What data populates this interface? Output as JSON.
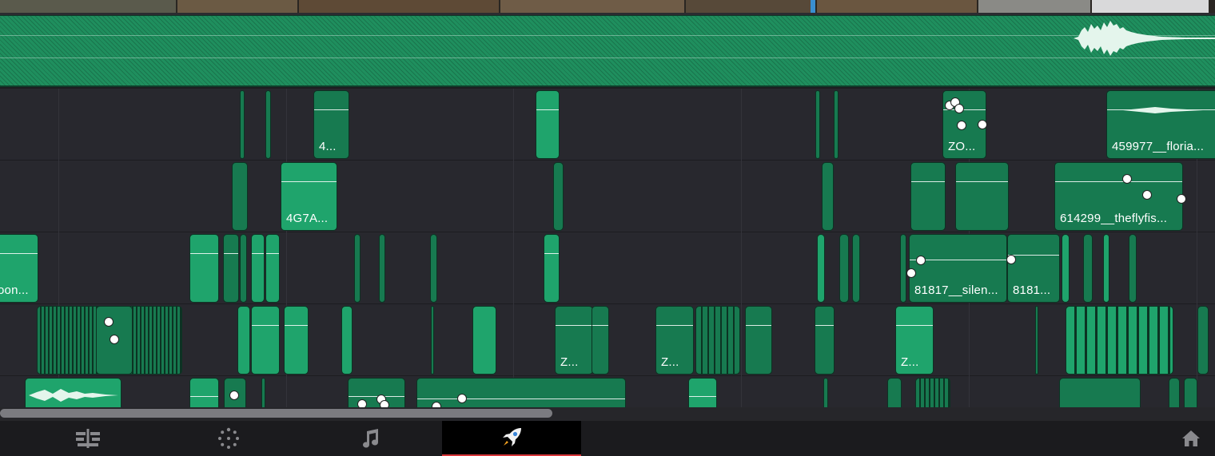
{
  "colors": {
    "clip": "#1fa46c",
    "clip_dark": "#177a50",
    "video_track": "#1f8f5e",
    "background": "#28282e",
    "active_tab_underline": "#d8363a"
  },
  "clips": {
    "c1": "4...",
    "c2": "ZO...",
    "c3": "459977__floria...",
    "c4": "4G7A...",
    "c5": "614299__theflyfis...",
    "c6": "oon...",
    "c7": "81817__silen...",
    "c8": "8181...",
    "c9": "Z...",
    "c10": "Z...",
    "c11": "Z..."
  },
  "bottom_nav": {
    "items": [
      {
        "icon": "edit-timeline-icon"
      },
      {
        "icon": "color-wheel-icon"
      },
      {
        "icon": "music-note-icon"
      },
      {
        "icon": "rocket-deliver-icon",
        "active": true
      },
      {
        "icon": "home-icon"
      }
    ]
  }
}
